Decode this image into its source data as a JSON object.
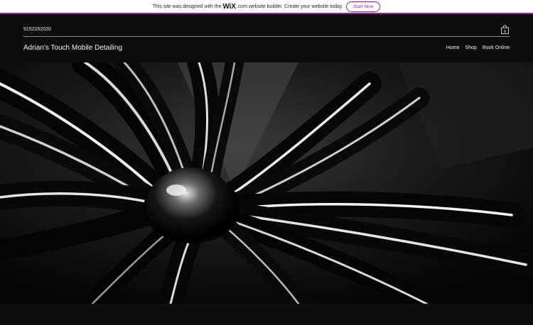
{
  "banner": {
    "text_before": "This site was designed with the",
    "wix_logo": "WiX",
    "text_after": ".com website builder. Create your website today.",
    "start_button": "Start Now"
  },
  "header": {
    "phone": "9152052020",
    "site_title": "Adrian's Touch Mobile Detailing",
    "cart_count": "0",
    "nav": [
      "Home",
      "Shop",
      "Book Online"
    ]
  },
  "colors": {
    "banner_accent": "#8a2a8c",
    "page_background": "#0d0d0d",
    "text": "#f2f2f2"
  },
  "icons": {
    "cart": "shopping-bag-icon"
  }
}
